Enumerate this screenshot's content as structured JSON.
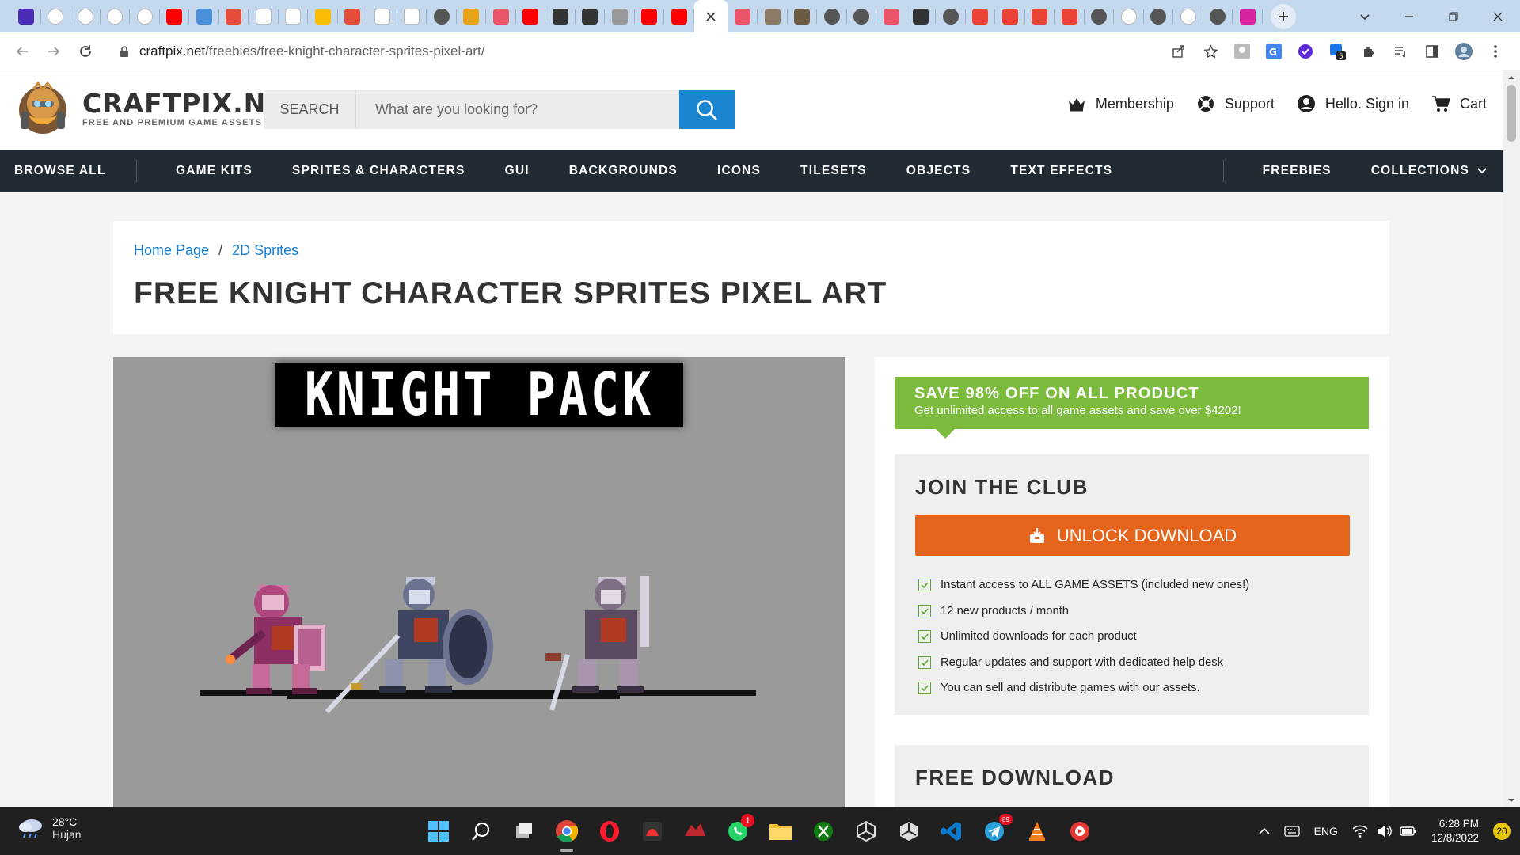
{
  "browser": {
    "tabs": [
      {
        "icon": "app-icon",
        "color": "#4a2bb5"
      },
      {
        "icon": "google-icon",
        "color": "#ffffff"
      },
      {
        "icon": "chatgpt-icon",
        "color": "#ffffff"
      },
      {
        "icon": "chatgpt-icon",
        "color": "#ffffff"
      },
      {
        "icon": "chatgpt-icon",
        "color": "#ffffff"
      },
      {
        "icon": "youtube-icon",
        "color": "#ff0000"
      },
      {
        "icon": "app-icon",
        "color": "#4a90d9"
      },
      {
        "icon": "app-icon",
        "color": "#e44d3a"
      },
      {
        "icon": "app-icon",
        "color": "#ffffff"
      },
      {
        "icon": "app-icon",
        "color": "#ffffff"
      },
      {
        "icon": "app-icon",
        "color": "#fbbc04"
      },
      {
        "icon": "app-icon",
        "color": "#e44d3a"
      },
      {
        "icon": "app-icon",
        "color": "#ffffff"
      },
      {
        "icon": "app-icon",
        "color": "#ffffff"
      },
      {
        "icon": "globe-icon",
        "color": "#555555"
      },
      {
        "icon": "app-icon",
        "color": "#e8a317"
      },
      {
        "icon": "app-icon",
        "color": "#e9546b"
      },
      {
        "icon": "youtube-icon",
        "color": "#ff0000"
      },
      {
        "icon": "github-icon",
        "color": "#333333"
      },
      {
        "icon": "github-icon",
        "color": "#333333"
      },
      {
        "icon": "app-icon",
        "color": "#999999"
      },
      {
        "icon": "youtube-icon",
        "color": "#ff0000"
      },
      {
        "icon": "youtube-icon",
        "color": "#ff0000"
      }
    ],
    "tabs_after": [
      {
        "icon": "app-icon",
        "color": "#e9546b"
      },
      {
        "icon": "app-icon",
        "color": "#8a7a66"
      },
      {
        "icon": "app-icon",
        "color": "#6b5b44"
      },
      {
        "icon": "globe-icon",
        "color": "#555555"
      },
      {
        "icon": "globe-icon",
        "color": "#555555"
      },
      {
        "icon": "app-icon",
        "color": "#e9546b"
      },
      {
        "icon": "app-icon",
        "color": "#333333"
      },
      {
        "icon": "globe-icon",
        "color": "#555555"
      },
      {
        "icon": "gmail-icon",
        "color": "#ea4335"
      },
      {
        "icon": "gmail-icon",
        "color": "#ea4335"
      },
      {
        "icon": "gmail-icon",
        "color": "#ea4335"
      },
      {
        "icon": "gmail-icon",
        "color": "#ea4335"
      },
      {
        "icon": "globe-icon",
        "color": "#555555"
      },
      {
        "icon": "google-icon",
        "color": "#ffffff"
      },
      {
        "icon": "globe-icon",
        "color": "#555555"
      },
      {
        "icon": "google-icon",
        "color": "#ffffff"
      },
      {
        "icon": "globe-icon",
        "color": "#555555"
      },
      {
        "icon": "instagram-icon",
        "color": "#d6249f"
      }
    ],
    "url_domain": "craftpix.net",
    "url_path": "/freebies/free-knight-character-sprites-pixel-art/"
  },
  "site": {
    "logo_title": "CRAFTPIX.NET",
    "logo_sub": "FREE AND PREMIUM GAME ASSETS",
    "search_label": "SEARCH",
    "search_placeholder": "What are you looking for?",
    "header_links": {
      "membership": "Membership",
      "support": "Support",
      "signin": "Hello. Sign in",
      "cart": "Cart"
    },
    "nav": {
      "browse_all": "BROWSE ALL",
      "items": [
        "GAME KITS",
        "SPRITES & CHARACTERS",
        "GUI",
        "BACKGROUNDS",
        "ICONS",
        "TILESETS",
        "OBJECTS",
        "TEXT EFFECTS"
      ],
      "freebies": "FREEBIES",
      "collections": "COLLECTIONS"
    },
    "colors": {
      "accent_blue": "#1a85d0",
      "promo_green": "#7dbb3d",
      "unlock_orange": "#e5641b",
      "nav_bg": "#222a33"
    }
  },
  "page": {
    "breadcrumb": {
      "home": "Home Page",
      "section": "2D Sprites",
      "separator": "/"
    },
    "title": "FREE KNIGHT CHARACTER SPRITES PIXEL ART",
    "hero_banner": "KNIGHT PACK",
    "promo": {
      "title": "SAVE 98% OFF ON ALL PRODUCT",
      "subtitle": "Get unlimited access to all game assets and save over $4202!"
    },
    "club": {
      "title": "JOIN THE CLUB",
      "unlock_label": "UNLOCK DOWNLOAD",
      "features": [
        "Instant access to ALL GAME ASSETS (included new ones!)",
        "12 new products / month",
        "Unlimited downloads for each product",
        "Regular updates and support with dedicated help desk",
        "You can sell and distribute games with our assets."
      ]
    },
    "free_download_title": "FREE DOWNLOAD"
  },
  "taskbar": {
    "weather_temp": "28°C",
    "weather_desc": "Hujan",
    "whatsapp_badge": "1",
    "telegram_badge": "89",
    "language": "ENG",
    "time": "6:28 PM",
    "date": "12/8/2022",
    "notifications": "20"
  }
}
